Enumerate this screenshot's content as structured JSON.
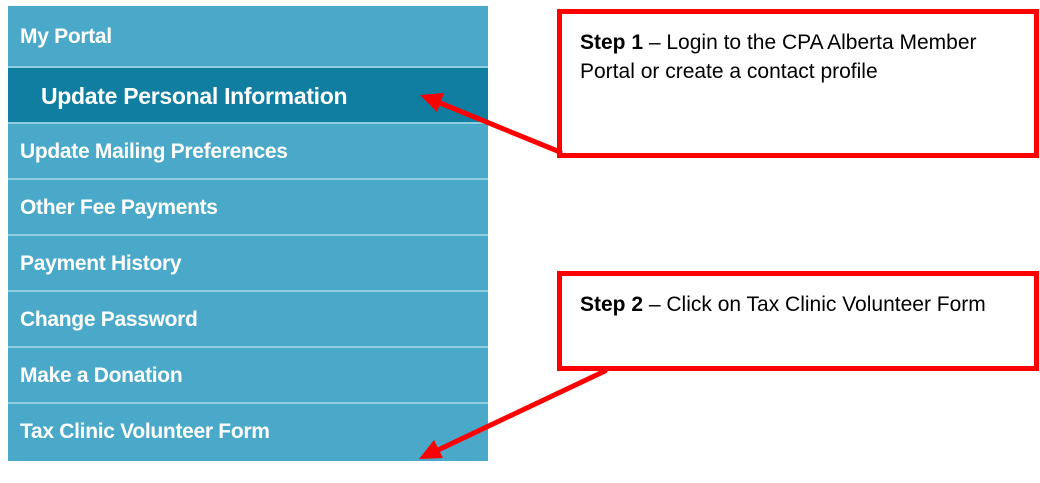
{
  "menu": {
    "items": [
      {
        "label": "My Portal"
      },
      {
        "label": "Update Personal Information"
      },
      {
        "label": "Update Mailing Preferences"
      },
      {
        "label": "Other Fee Payments"
      },
      {
        "label": "Payment History"
      },
      {
        "label": "Change Password"
      },
      {
        "label": "Make a Donation"
      },
      {
        "label": "Tax Clinic Volunteer Form"
      }
    ]
  },
  "callouts": [
    {
      "step": "Step 1",
      "text": " – Login to the CPA Alberta Member Portal or create a contact profile"
    },
    {
      "step": "Step 2",
      "text": " – Click on Tax Clinic Volunteer Form"
    }
  ],
  "colors": {
    "menu_bg": "#4aa9c9",
    "menu_active_bg": "#0f7ea1",
    "callout_border": "#ff0000",
    "arrow": "#ff0000"
  }
}
